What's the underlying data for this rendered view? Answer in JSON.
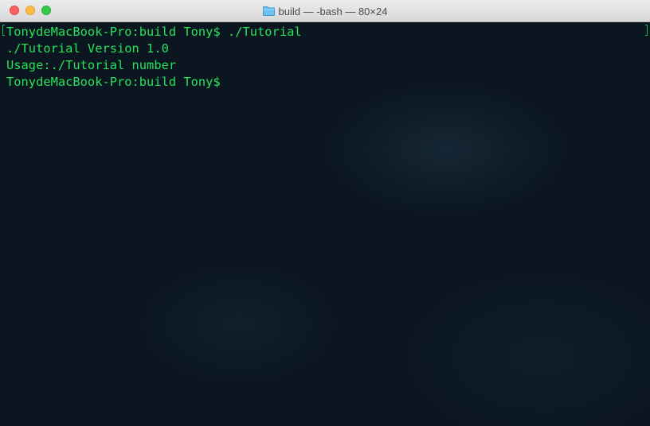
{
  "window": {
    "title": "build — -bash — 80×24",
    "title_icon": "folder-icon",
    "colors": {
      "close": "#fc605c",
      "minimize": "#fdbc40",
      "zoom": "#34c84a",
      "terminal_text": "#28e25a",
      "terminal_background": "#0b1620"
    }
  },
  "terminal": {
    "lines": [
      "TonydeMacBook-Pro:build Tony$ ./Tutorial",
      "./Tutorial Version 1.0",
      "Usage:./Tutorial number",
      "TonydeMacBook-Pro:build Tony$ "
    ]
  }
}
